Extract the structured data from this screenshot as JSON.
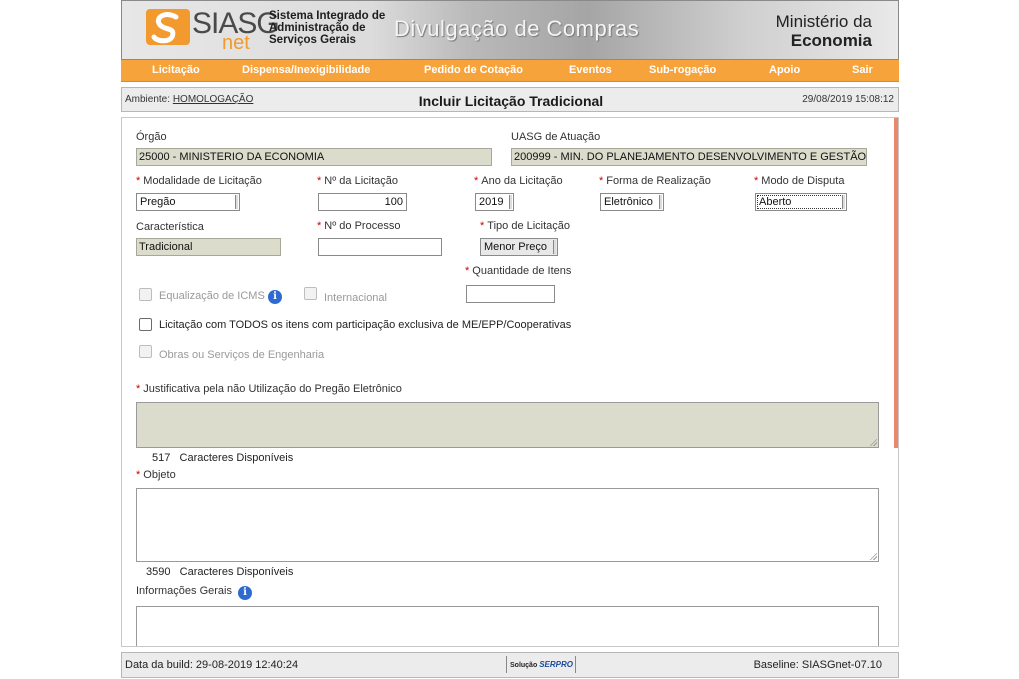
{
  "header": {
    "logo_text": "SIASG",
    "logo_sub": "net",
    "system_name": "Sistema Integrado de Administração de Serviços Gerais",
    "banner_title": "Divulgação de Compras",
    "ministry_line1": "Ministério da",
    "ministry_line2": "Economia"
  },
  "nav": {
    "items": [
      {
        "label": "Licitação"
      },
      {
        "label": "Dispensa/Inexigibilidade"
      },
      {
        "label": "Pedido de Cotação"
      },
      {
        "label": "Eventos"
      },
      {
        "label": "Sub-rogação"
      },
      {
        "label": "Apoio"
      },
      {
        "label": "Sair"
      }
    ]
  },
  "envbar": {
    "label": "Ambiente:",
    "value": "HOMOLOGAÇÃO",
    "title": "Incluir Licitação Tradicional",
    "datetime": "29/08/2019 15:08:12"
  },
  "form": {
    "orgao": {
      "label": "Órgão",
      "value": "25000 - MINISTERIO DA ECONOMIA"
    },
    "uasg": {
      "label": "UASG de Atuação",
      "value": "200999 - MIN. DO PLANEJAMENTO DESENVOLVIMENTO E GESTÃO"
    },
    "modalidade": {
      "label": "Modalidade de Licitação",
      "value": "Pregão"
    },
    "numero": {
      "label": "Nº da Licitação",
      "value": "100"
    },
    "ano": {
      "label": "Ano da Licitação",
      "value": "2019"
    },
    "forma": {
      "label": "Forma de Realização",
      "value": "Eletrônico"
    },
    "modo": {
      "label": "Modo de Disputa",
      "value": "Aberto"
    },
    "caracteristica": {
      "label": "Característica",
      "value": "Tradicional"
    },
    "processo": {
      "label": "Nº do Processo",
      "value": ""
    },
    "tipo": {
      "label": "Tipo de Licitação",
      "value": "Menor Preço"
    },
    "quantidade": {
      "label": "Quantidade de Itens",
      "value": ""
    },
    "equalizacao": {
      "label": "Equalização de ICMS"
    },
    "internacional": {
      "label": "Internacional"
    },
    "me_epp": {
      "label": "Licitação com TODOS os itens com participação exclusiva de ME/EPP/Cooperativas"
    },
    "obras": {
      "label": "Obras ou Serviços de Engenharia"
    },
    "justificativa": {
      "label": "Justificativa pela não Utilização do Pregão Eletrônico",
      "count": "517",
      "count_label": "Caracteres Disponíveis"
    },
    "objeto": {
      "label": "Objeto",
      "count": "3590",
      "count_label": "Caracteres Disponíveis"
    },
    "informacoes": {
      "label": "Informações Gerais"
    },
    "required_mark": "*",
    "info_glyph": "i"
  },
  "footer": {
    "build": "Data da build: 29-08-2019 12:40:24",
    "serpro_prefix": "Solução",
    "serpro_brand": "SERPRO",
    "baseline": "Baseline: SIASGnet-07.10"
  },
  "colors": {
    "nav_orange": "#f7a33c",
    "readonly_field": "#dcdccc",
    "required_red": "#cc0000",
    "info_blue": "#2e6bd0"
  }
}
